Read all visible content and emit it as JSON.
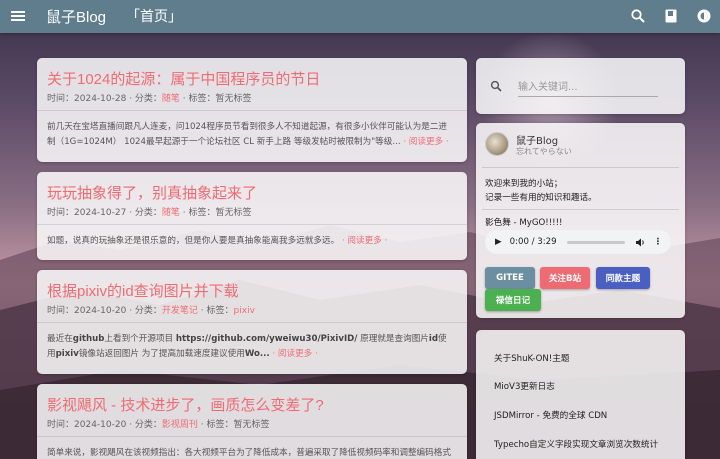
{
  "topbar": {
    "brand": "鼠子Blog",
    "breadcrumb": "「首页」",
    "icons": [
      "menu-icon",
      "search-icon",
      "book-icon",
      "theme-icon"
    ]
  },
  "posts": [
    {
      "title": "关于1024的起源：属于中国程序员的节日",
      "time_label": "时间：",
      "date": "2024-10-28",
      "cat_label": " · 分类：",
      "category": "随笔",
      "tag_label": " · 标签：",
      "tags": "暂无标签",
      "excerpt": "前几天在宝塔直播间跟凡人连麦，问1024程序员节看到很多人不知道起源，有很多小伙伴可能认为是二进制（1G=1024M） 1024最早起源于一个论坛社区 CL 新手上路 等级发帖时被限制为\"等级... ",
      "more": "· 阅读更多 ·"
    },
    {
      "title": "玩玩抽象得了，别真抽象起来了",
      "time_label": "时间：",
      "date": "2024-10-27",
      "cat_label": " · 分类：",
      "category": "随笔",
      "tag_label": " · 标签：",
      "tags": "暂无标签",
      "excerpt": "如题，说真的玩抽象还是很乐意的，但是你人要是真抽象能离我多远就多远。",
      "more": "· 阅读更多 ·"
    },
    {
      "title": "根据pixiv的id查询图片并下载",
      "time_label": "时间：",
      "date": "2024-10-20",
      "cat_label": " · 分类：",
      "category": "开发笔记",
      "tag_label": " · 标签：",
      "tags": "pixiv",
      "excerpt_a": "最近在",
      "excerpt_b": "github",
      "excerpt_c": "上看到个开源项目 ",
      "excerpt_d": "https://github.com/yweiwu30/PixivID/",
      "excerpt_e": " 原理就是查询图片",
      "excerpt_f": "id",
      "excerpt_g": "使用",
      "excerpt_h": "pixiv",
      "excerpt_i": "镜像站返回图片 为了提高加载速度建议使用",
      "excerpt_j": "Wo...",
      "more": "· 阅读更多 ·"
    },
    {
      "title": "影视飓风 - 技术进步了，画质怎么变差了?",
      "time_label": "时间：",
      "date": "2024-10-20",
      "cat_label": " · 分类：",
      "category": "影视周刊",
      "tag_label": " · 标签：",
      "tags": "暂无标签",
      "excerpt": "简单来说，影视飓风在该视频指出：各大视频平台为了降低成本，普遍采取了降低视频码率和调整编码格式等"
    }
  ],
  "search": {
    "placeholder": "输入关键词..."
  },
  "profile": {
    "name": "鼠子Blog",
    "subtitle": "忘れてやらない",
    "intro_line1": "欢迎来到我的小站；",
    "intro_line2": "记录一些有用的知识和趣话。",
    "song": "影色舞 - MyGO!!!!!",
    "player_time": "0:00 / 3:29",
    "buttons": [
      {
        "label": "GITEE",
        "color": "#6b8ea0"
      },
      {
        "label": "关注B站",
        "color": "#ef6b73"
      },
      {
        "label": "同款主题",
        "color": "#4a5fc1"
      },
      {
        "label": "禄信日记",
        "color": "#4caf50"
      }
    ]
  },
  "recent": [
    {
      "title": "关于ShuK-ON!主题"
    },
    {
      "title": "MioV3更新日志"
    },
    {
      "title": "JSDMirror - 免费的全球 CDN"
    },
    {
      "title": "Typecho自定义字段实现文章浏览次数统计"
    }
  ]
}
